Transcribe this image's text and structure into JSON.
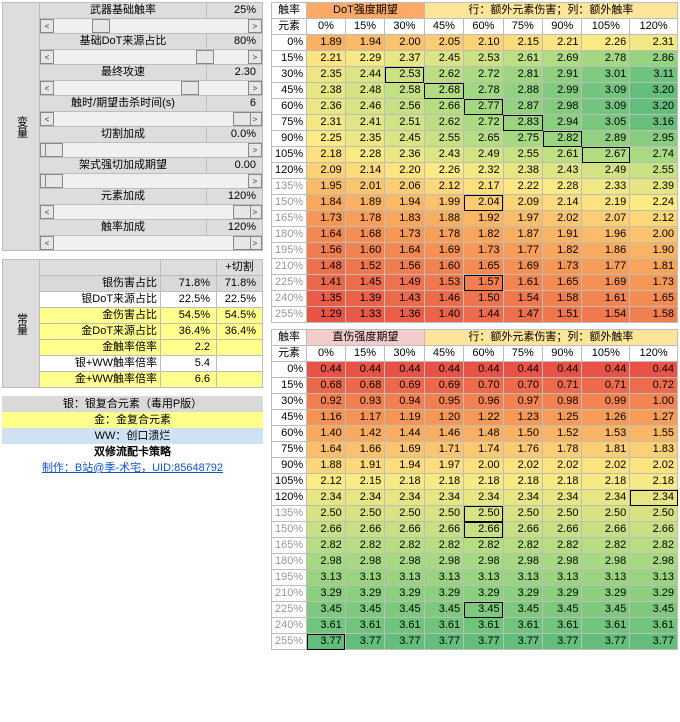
{
  "leftHeader": "变量",
  "constHeader": "常量",
  "variables": [
    {
      "label": "武器基础触率",
      "value": "25%",
      "thumb": 0.24
    },
    {
      "label": "基础DoT来源占比",
      "value": "80%",
      "thumb": 0.78
    },
    {
      "label": "最终攻速",
      "value": "2.30",
      "thumb": 0.7
    },
    {
      "label": "触时/期望击杀时间(s)",
      "value": "6",
      "thumb": 0.97
    },
    {
      "label": "切割加成",
      "value": "0.0%",
      "thumb": 0.0
    },
    {
      "label": "架式强切加成期望",
      "value": "0.00",
      "thumb": 0.0
    },
    {
      "label": "元素加成",
      "value": "120%",
      "thumb": 0.97
    },
    {
      "label": "触率加成",
      "value": "120%",
      "thumb": 0.97
    }
  ],
  "constExtraHeader": "+切割",
  "constants": [
    {
      "cls": "row-silver",
      "label": "银伤害占比",
      "a": "71.8%",
      "b": "71.8%"
    },
    {
      "cls": "row-plain",
      "label": "银DoT来源占比",
      "a": "22.5%",
      "b": "22.5%"
    },
    {
      "cls": "row-gold",
      "label": "金伤害占比",
      "a": "54.5%",
      "b": "54.5%"
    },
    {
      "cls": "row-gold",
      "label": "金DoT来源占比",
      "a": "36.4%",
      "b": "36.4%"
    },
    {
      "cls": "row-gold",
      "label": "金触率倍率",
      "a": "2.2",
      "b": ""
    },
    {
      "cls": "row-plain",
      "label": "银+WW触率倍率",
      "a": "5.4",
      "b": ""
    },
    {
      "cls": "row-gold",
      "label": "金+WW触率倍率",
      "a": "6.6",
      "b": ""
    }
  ],
  "legend": {
    "silver": "银：银复合元素（毒用P版）",
    "gold": "金：金复合元素",
    "ww": "WW：创口溃烂",
    "title": "双修流配卡策略",
    "byline": "制作：B站@季-术宅，UID:85648792"
  },
  "heat1": {
    "rowHeader": "触率",
    "elemHeader": "元素",
    "title": "DoT强度期望",
    "note": "行：额外元素伤害；列：额外触率",
    "cols": [
      "0%",
      "15%",
      "30%",
      "45%",
      "60%",
      "75%",
      "90%",
      "105%",
      "120%"
    ],
    "rows": [
      "0%",
      "15%",
      "30%",
      "45%",
      "60%",
      "75%",
      "90%",
      "105%",
      "120%",
      "135%",
      "150%",
      "165%",
      "180%",
      "195%",
      "210%",
      "225%",
      "240%",
      "255%"
    ],
    "grid": [
      [
        "1.89",
        "1.94",
        "2.00",
        "2.05",
        "2.10",
        "2.15",
        "2.21",
        "2.26",
        "2.31"
      ],
      [
        "2.21",
        "2.29",
        "2.37",
        "2.45",
        "2.53",
        "2.61",
        "2.69",
        "2.78",
        "2.86"
      ],
      [
        "2.35",
        "2.44",
        "2.53",
        "2.62",
        "2.72",
        "2.81",
        "2.91",
        "3.01",
        "3.11"
      ],
      [
        "2.38",
        "2.48",
        "2.58",
        "2.68",
        "2.78",
        "2.88",
        "2.99",
        "3.09",
        "3.20"
      ],
      [
        "2.36",
        "2.46",
        "2.56",
        "2.66",
        "2.77",
        "2.87",
        "2.98",
        "3.09",
        "3.20"
      ],
      [
        "2.31",
        "2.41",
        "2.51",
        "2.62",
        "2.72",
        "2.83",
        "2.94",
        "3.05",
        "3.16"
      ],
      [
        "2.25",
        "2.35",
        "2.45",
        "2.55",
        "2.65",
        "2.75",
        "2.82",
        "2.89",
        "2.95"
      ],
      [
        "2.18",
        "2.28",
        "2.36",
        "2.43",
        "2.49",
        "2.55",
        "2.61",
        "2.67",
        "2.74"
      ],
      [
        "2.09",
        "2.14",
        "2.20",
        "2.26",
        "2.32",
        "2.38",
        "2.43",
        "2.49",
        "2.55"
      ],
      [
        "1.95",
        "2.01",
        "2.06",
        "2.12",
        "2.17",
        "2.22",
        "2.28",
        "2.33",
        "2.39"
      ],
      [
        "1.84",
        "1.89",
        "1.94",
        "1.99",
        "2.04",
        "2.09",
        "2.14",
        "2.19",
        "2.24"
      ],
      [
        "1.73",
        "1.78",
        "1.83",
        "1.88",
        "1.92",
        "1.97",
        "2.02",
        "2.07",
        "2.12"
      ],
      [
        "1.64",
        "1.68",
        "1.73",
        "1.78",
        "1.82",
        "1.87",
        "1.91",
        "1.96",
        "2.00"
      ],
      [
        "1.56",
        "1.60",
        "1.64",
        "1.69",
        "1.73",
        "1.77",
        "1.82",
        "1.86",
        "1.90"
      ],
      [
        "1.48",
        "1.52",
        "1.56",
        "1.60",
        "1.65",
        "1.69",
        "1.73",
        "1.77",
        "1.81"
      ],
      [
        "1.41",
        "1.45",
        "1.49",
        "1.53",
        "1.57",
        "1.61",
        "1.65",
        "1.69",
        "1.73"
      ],
      [
        "1.35",
        "1.39",
        "1.43",
        "1.46",
        "1.50",
        "1.54",
        "1.58",
        "1.61",
        "1.65"
      ],
      [
        "1.29",
        "1.33",
        "1.36",
        "1.40",
        "1.44",
        "1.47",
        "1.51",
        "1.54",
        "1.58"
      ]
    ],
    "greys": [
      9,
      10,
      11,
      12,
      13,
      14,
      15,
      16,
      17
    ],
    "boxed": [
      [
        2,
        2
      ],
      [
        3,
        3
      ],
      [
        4,
        4
      ],
      [
        5,
        5
      ],
      [
        6,
        6
      ],
      [
        7,
        7
      ],
      [
        10,
        4
      ],
      [
        15,
        4
      ]
    ]
  },
  "heat2": {
    "rowHeader": "触率",
    "elemHeader": "元素",
    "title": "直伤强度期望",
    "note": "行：额外元素伤害；列：额外触率",
    "cols": [
      "0%",
      "15%",
      "30%",
      "45%",
      "60%",
      "75%",
      "90%",
      "105%",
      "120%"
    ],
    "rows": [
      "0%",
      "15%",
      "30%",
      "45%",
      "60%",
      "75%",
      "90%",
      "105%",
      "120%",
      "135%",
      "150%",
      "165%",
      "180%",
      "195%",
      "210%",
      "225%",
      "240%",
      "255%"
    ],
    "grid": [
      [
        "0.44",
        "0.44",
        "0.44",
        "0.44",
        "0.44",
        "0.44",
        "0.44",
        "0.44",
        "0.44"
      ],
      [
        "0.68",
        "0.68",
        "0.69",
        "0.69",
        "0.70",
        "0.70",
        "0.71",
        "0.71",
        "0.72"
      ],
      [
        "0.92",
        "0.93",
        "0.94",
        "0.95",
        "0.96",
        "0.97",
        "0.98",
        "0.99",
        "1.00"
      ],
      [
        "1.16",
        "1.17",
        "1.19",
        "1.20",
        "1.22",
        "1.23",
        "1.25",
        "1.26",
        "1.27"
      ],
      [
        "1.40",
        "1.42",
        "1.44",
        "1.46",
        "1.48",
        "1.50",
        "1.52",
        "1.53",
        "1.55"
      ],
      [
        "1.64",
        "1.66",
        "1.69",
        "1.71",
        "1.74",
        "1.76",
        "1.78",
        "1.81",
        "1.83"
      ],
      [
        "1.88",
        "1.91",
        "1.94",
        "1.97",
        "2.00",
        "2.02",
        "2.02",
        "2.02",
        "2.02"
      ],
      [
        "2.12",
        "2.15",
        "2.18",
        "2.18",
        "2.18",
        "2.18",
        "2.18",
        "2.18",
        "2.18"
      ],
      [
        "2.34",
        "2.34",
        "2.34",
        "2.34",
        "2.34",
        "2.34",
        "2.34",
        "2.34",
        "2.34"
      ],
      [
        "2.50",
        "2.50",
        "2.50",
        "2.50",
        "2.50",
        "2.50",
        "2.50",
        "2.50",
        "2.50"
      ],
      [
        "2.66",
        "2.66",
        "2.66",
        "2.66",
        "2.66",
        "2.66",
        "2.66",
        "2.66",
        "2.66"
      ],
      [
        "2.82",
        "2.82",
        "2.82",
        "2.82",
        "2.82",
        "2.82",
        "2.82",
        "2.82",
        "2.82"
      ],
      [
        "2.98",
        "2.98",
        "2.98",
        "2.98",
        "2.98",
        "2.98",
        "2.98",
        "2.98",
        "2.98"
      ],
      [
        "3.13",
        "3.13",
        "3.13",
        "3.13",
        "3.13",
        "3.13",
        "3.13",
        "3.13",
        "3.13"
      ],
      [
        "3.29",
        "3.29",
        "3.29",
        "3.29",
        "3.29",
        "3.29",
        "3.29",
        "3.29",
        "3.29"
      ],
      [
        "3.45",
        "3.45",
        "3.45",
        "3.45",
        "3.45",
        "3.45",
        "3.45",
        "3.45",
        "3.45"
      ],
      [
        "3.61",
        "3.61",
        "3.61",
        "3.61",
        "3.61",
        "3.61",
        "3.61",
        "3.61",
        "3.61"
      ],
      [
        "3.77",
        "3.77",
        "3.77",
        "3.77",
        "3.77",
        "3.77",
        "3.77",
        "3.77",
        "3.77"
      ]
    ],
    "greys": [
      9,
      10,
      11,
      12,
      13,
      14,
      15,
      16,
      17
    ],
    "boxed": [
      [
        8,
        8
      ],
      [
        9,
        4
      ],
      [
        10,
        4
      ],
      [
        15,
        4
      ],
      [
        17,
        0
      ]
    ]
  }
}
